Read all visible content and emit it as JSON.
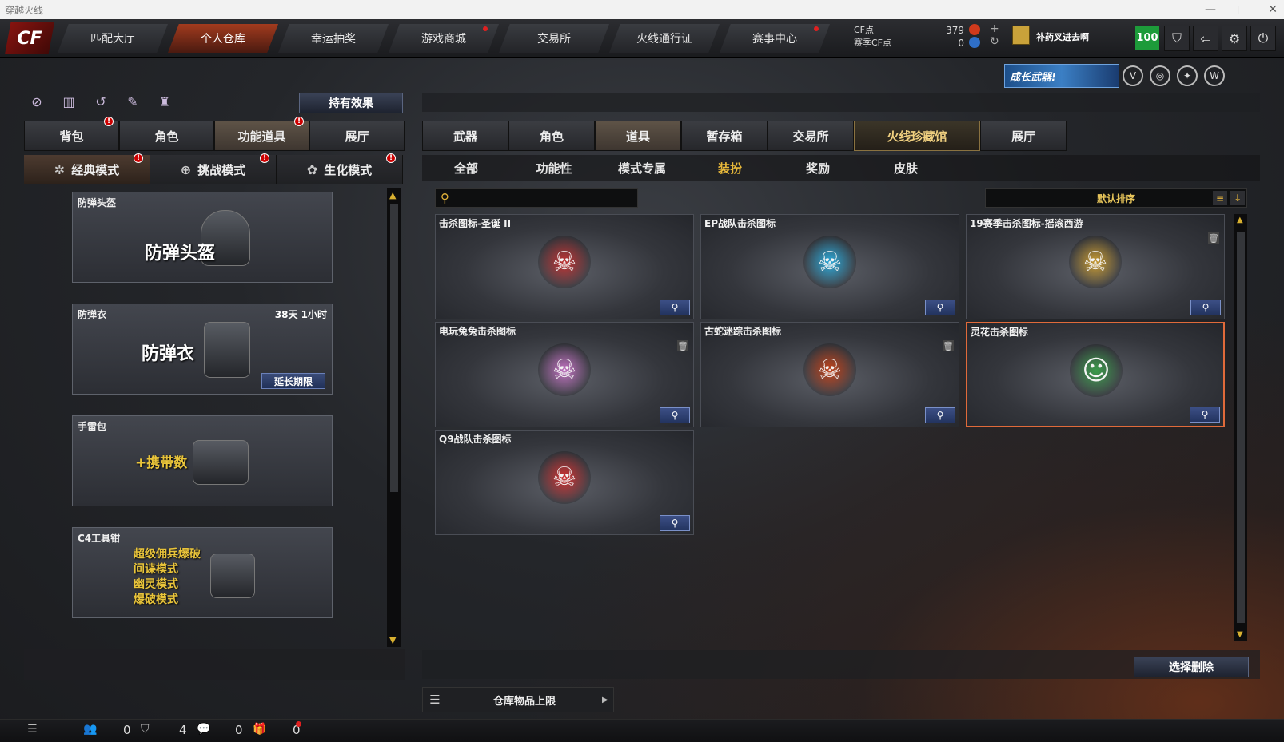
{
  "window": {
    "title": "穿越火线"
  },
  "topnav": {
    "logo": "CF",
    "tabs": [
      {
        "label": "匹配大厅",
        "active": false,
        "dot": false
      },
      {
        "label": "个人仓库",
        "active": true,
        "dot": false
      },
      {
        "label": "幸运抽奖",
        "active": false,
        "dot": false
      },
      {
        "label": "游戏商城",
        "active": false,
        "dot": true
      },
      {
        "label": "交易所",
        "active": false,
        "dot": false
      },
      {
        "label": "火线通行证",
        "active": false,
        "dot": false
      },
      {
        "label": "赛事中心",
        "active": false,
        "dot": true
      }
    ],
    "cf_label": "CF点",
    "season_cf_label": "赛季CF点",
    "cf_value": "379",
    "season_cf_value": "0",
    "player_name": "补药叉进去啊",
    "level": "100"
  },
  "banner": {
    "label": "成长武器!"
  },
  "left": {
    "holding_effects": "持有效果",
    "tabs": [
      {
        "label": "背包",
        "badge": true
      },
      {
        "label": "角色",
        "badge": false
      },
      {
        "label": "功能道具",
        "badge": true,
        "active": true
      },
      {
        "label": "展厅",
        "badge": false
      }
    ],
    "modes": [
      {
        "label": "经典模式",
        "badge": "!",
        "active": true
      },
      {
        "label": "挑战模式",
        "badge": "!"
      },
      {
        "label": "生化模式",
        "badge": "!"
      }
    ],
    "items": [
      {
        "name": "防弹头盔",
        "big": "防弹头盔"
      },
      {
        "name": "防弹衣",
        "big": "防弹衣",
        "time": "38天 1小时",
        "extend": "延长期限"
      },
      {
        "name": "手雷包",
        "big": "+携带数"
      },
      {
        "name": "C4工具钳",
        "lines": [
          "超级佣兵爆破",
          "间谍模式",
          "幽灵模式",
          "爆破模式"
        ]
      }
    ]
  },
  "right": {
    "tabs": [
      {
        "label": "武器"
      },
      {
        "label": "角色"
      },
      {
        "label": "道具",
        "active": true
      },
      {
        "label": "暂存箱"
      },
      {
        "label": "交易所"
      },
      {
        "label": "火线珍藏馆",
        "collect": true
      },
      {
        "label": "展厅"
      }
    ],
    "subtabs": [
      {
        "label": "全部"
      },
      {
        "label": "功能性"
      },
      {
        "label": "模式专属"
      },
      {
        "label": "装扮",
        "active": true
      },
      {
        "label": "奖励"
      },
      {
        "label": "皮肤"
      }
    ],
    "search_placeholder": "",
    "sort_label": "默认排序",
    "cards": [
      {
        "name": "击杀图标-圣诞 II",
        "emblem": "☠",
        "color": "#c03030",
        "trash": false,
        "selected": false
      },
      {
        "name": "EP战队击杀图标",
        "emblem": "☠",
        "color": "#2aa8d8",
        "trash": false,
        "selected": false
      },
      {
        "name": "19赛季击杀图标-摇滚西游",
        "emblem": "☠",
        "color": "#c89a30",
        "trash": true,
        "selected": false
      },
      {
        "name": "电玩兔兔击杀图标",
        "emblem": "☠",
        "color": "#c070c0",
        "trash": true,
        "selected": false
      },
      {
        "name": "古蛇迷踪击杀图标",
        "emblem": "☠",
        "color": "#c04018",
        "trash": true,
        "selected": false
      },
      {
        "name": "灵花击杀图标",
        "emblem": "☺",
        "color": "#3a9a4a",
        "trash": false,
        "selected": true
      },
      {
        "name": "Q9战队击杀图标",
        "emblem": "☠",
        "color": "#d03030",
        "trash": false,
        "selected": false
      }
    ],
    "delete_label": "选择删除",
    "capacity_label": "仓库物品上限"
  },
  "statusbar": {
    "counts": [
      "0",
      "4",
      "0",
      "0"
    ]
  }
}
